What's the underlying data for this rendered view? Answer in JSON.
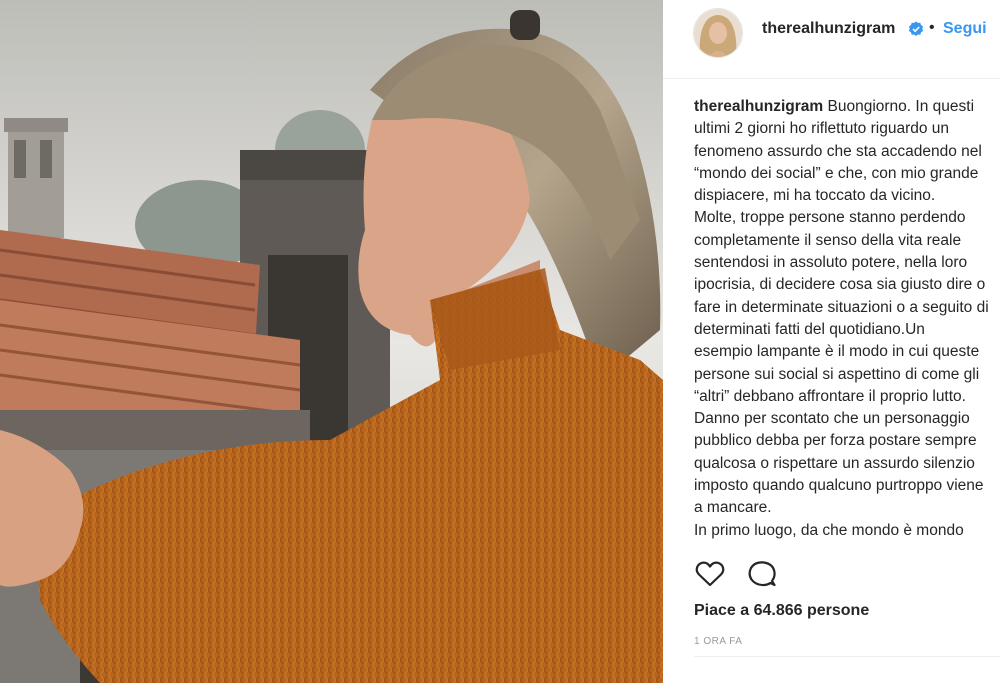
{
  "post": {
    "photo_alt": "photo",
    "username": "therealhunzigram",
    "verified_icon": "verified-badge-icon",
    "separator": "•",
    "follow_label": "Segui",
    "caption": {
      "author": "therealhunzigram",
      "first_line": "Buongiorno. In questi",
      "lines": [
        "ultimi 2 giorni ho riflettuto riguardo un",
        "fenomeno assurdo che sta accadendo nel",
        "“mondo dei social” e che, con mio grande",
        "dispiacere, mi ha toccato da vicino.",
        "Molte, troppe persone stanno perdendo",
        "completamente il senso della vita reale",
        "sentendosi in assoluto potere, nella loro",
        "ipocrisia, di decidere cosa sia giusto dire o",
        "fare in determinate situazioni o a seguito di",
        "determinati fatti del quotidiano.Un",
        "esempio lampante è il modo in cui queste",
        "persone sui social si aspettino di come gli",
        "“altri” debbano affrontare il proprio lutto.",
        "Danno per scontato che un personaggio",
        "pubblico debba per forza postare sempre",
        "qualcosa o rispettare un assurdo silenzio",
        "imposto quando qualcuno purtroppo viene",
        "a mancare.",
        "In primo luogo, da che mondo è mondo"
      ]
    },
    "actions": {
      "like_icon": "heart-icon",
      "comment_icon": "comment-icon"
    },
    "likes_text": "Piace a 64.866 persone",
    "timestamp": "1 ORA FA"
  },
  "colors": {
    "accent": "#3897f0",
    "text": "#262626",
    "muted": "#999999"
  }
}
